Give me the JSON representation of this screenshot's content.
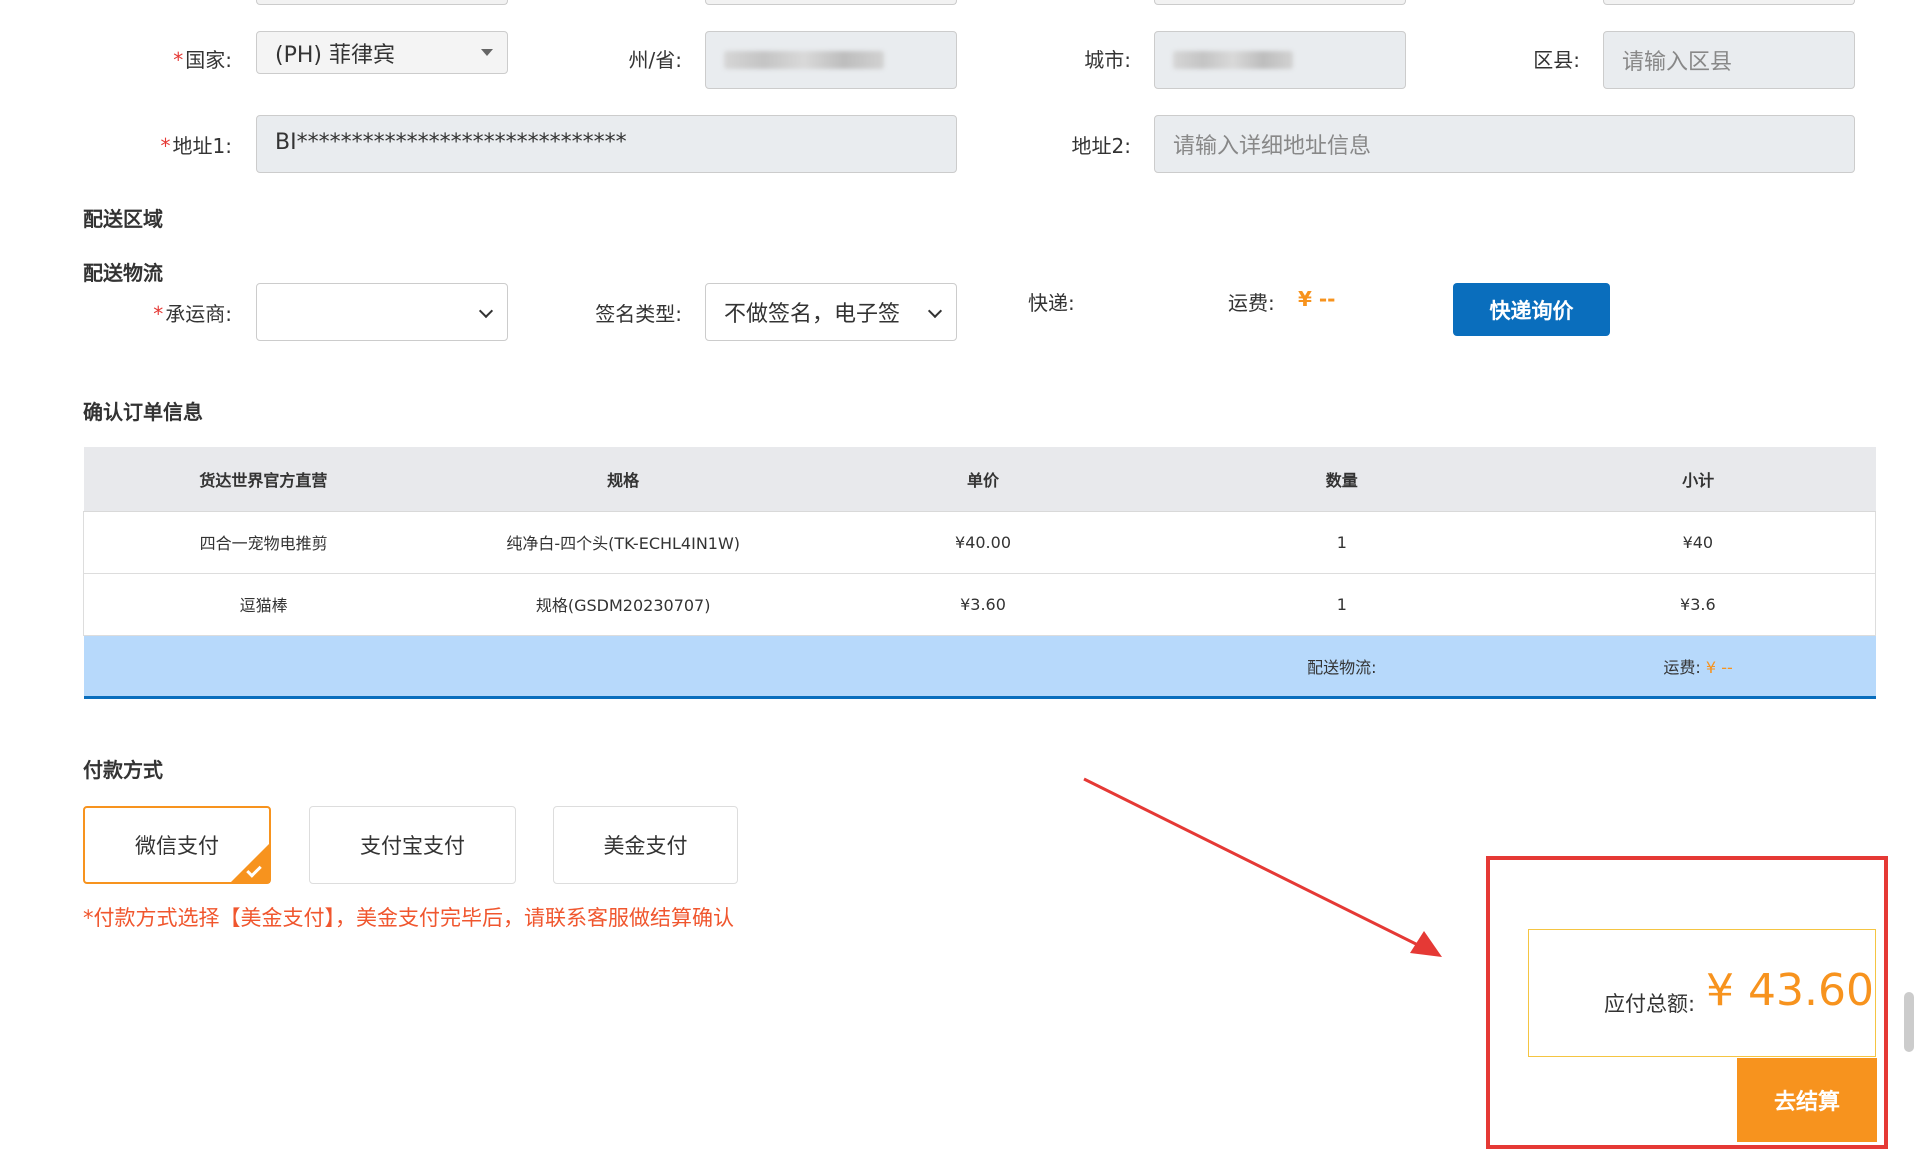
{
  "address": {
    "country_label": "国家:",
    "country_value": "(PH) 菲律宾",
    "state_label": "州/省:",
    "city_label": "城市:",
    "district_label": "区县:",
    "district_placeholder": "请输入区县",
    "addr1_label": "地址1:",
    "addr1_value": "BI******************************",
    "addr2_label": "地址2:",
    "addr2_placeholder": "请输入详细地址信息"
  },
  "delivery": {
    "area_title": "配送区域",
    "logistics_title": "配送物流",
    "carrier_label": "承运商:",
    "signature_label": "签名类型:",
    "signature_value": "不做签名，电子签",
    "express_label": "快递:",
    "freight_label": "运费:",
    "freight_value": "¥ --",
    "quote_button": "快递询价"
  },
  "order": {
    "title": "确认订单信息",
    "columns": [
      "货达世界官方直营",
      "规格",
      "单价",
      "数量",
      "小计"
    ],
    "rows": [
      {
        "name": "四合一宠物电推剪",
        "spec": "纯净白-四个头(TK-ECHL4IN1W)",
        "price": "¥40.00",
        "qty": "1",
        "subtotal": "¥40"
      },
      {
        "name": "逗猫棒",
        "spec": "规格(GSDM20230707)",
        "price": "¥3.60",
        "qty": "1",
        "subtotal": "¥3.6"
      }
    ],
    "summary_logistics": "配送物流:",
    "summary_freight_label": "运费:",
    "summary_freight_value": "¥ --"
  },
  "payment": {
    "title": "付款方式",
    "options": [
      "微信支付",
      "支付宝支付",
      "美金支付"
    ],
    "selected_index": 0,
    "note": "*付款方式选择【美金支付】，美金支付完毕后，请联系客服做结算确认"
  },
  "total": {
    "label": "应付总额:",
    "value": "¥ 43.60",
    "checkout_button": "去结算"
  },
  "colors": {
    "accent_orange": "#f7931e",
    "primary_blue": "#0a6ebd",
    "annotation_red": "#e53935"
  }
}
